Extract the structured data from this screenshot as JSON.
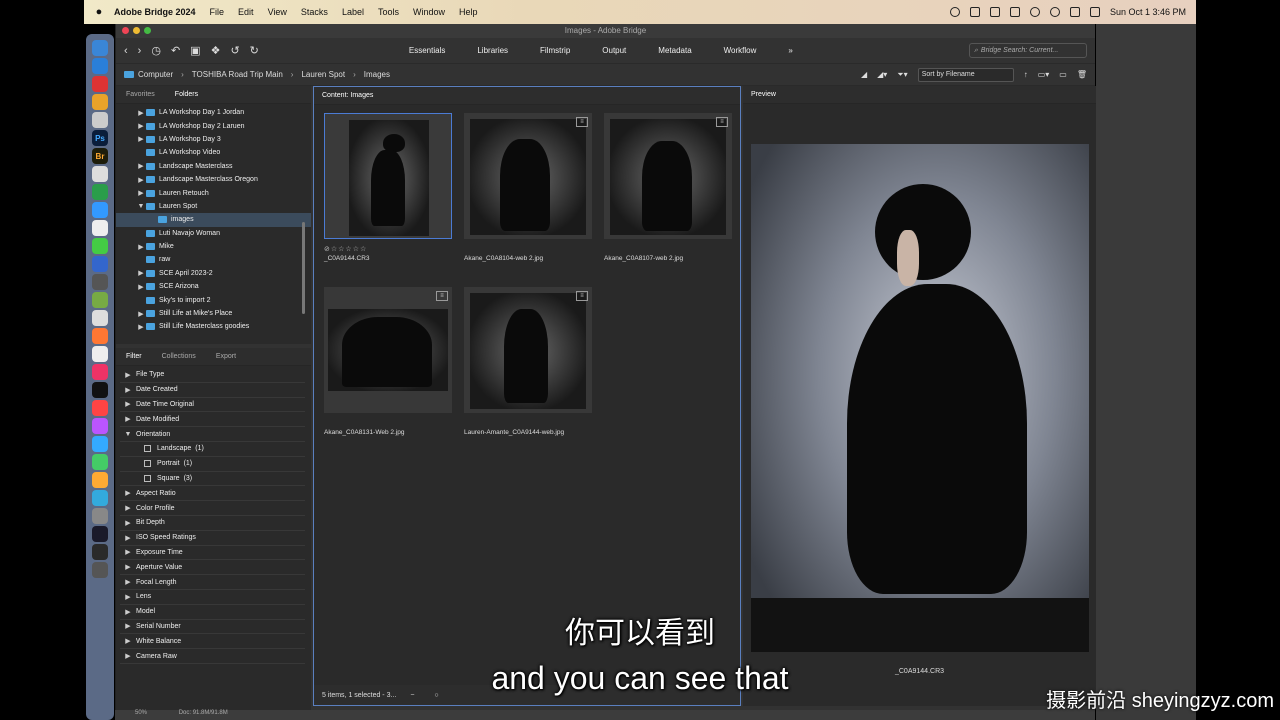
{
  "menubar": {
    "app_name": "Adobe Bridge 2024",
    "menus": [
      "File",
      "Edit",
      "View",
      "Stacks",
      "Label",
      "Tools",
      "Window",
      "Help"
    ],
    "clock": "Sun Oct 1  3:46 PM"
  },
  "window": {
    "title": "Images - Adobe Bridge",
    "workspaces": [
      "Essentials",
      "Libraries",
      "Filmstrip",
      "Output",
      "Metadata",
      "Workflow"
    ],
    "search_placeholder": "Bridge Search: Current..."
  },
  "path": [
    "Computer",
    "TOSHIBA Road Trip Main",
    "Lauren Spot",
    "Images"
  ],
  "sort_label": "Sort by Filename",
  "left_tabs": [
    "Favorites",
    "Folders"
  ],
  "folders": [
    {
      "label": "LA Workshop Day 1 Jordan",
      "arrow": "▶",
      "indent": 0
    },
    {
      "label": "LA Workshop Day 2 Laruen",
      "arrow": "▶",
      "indent": 0
    },
    {
      "label": "LA Workshop Day 3",
      "arrow": "▶",
      "indent": 0
    },
    {
      "label": "LA Workshop Video",
      "arrow": "",
      "indent": 0
    },
    {
      "label": "Landscape Masterclass",
      "arrow": "▶",
      "indent": 0
    },
    {
      "label": "Landscape Masterclass Oregon",
      "arrow": "▶",
      "indent": 0
    },
    {
      "label": "Lauren Retouch",
      "arrow": "▶",
      "indent": 0
    },
    {
      "label": "Lauren Spot",
      "arrow": "▼",
      "indent": 0
    },
    {
      "label": "images",
      "arrow": "",
      "indent": 1
    },
    {
      "label": "Luti Navajo Woman",
      "arrow": "",
      "indent": 0
    },
    {
      "label": "Mike",
      "arrow": "▶",
      "indent": 0
    },
    {
      "label": "raw",
      "arrow": "",
      "indent": 0
    },
    {
      "label": "SCE April 2023-2",
      "arrow": "▶",
      "indent": 0
    },
    {
      "label": "SCE Arizona",
      "arrow": "▶",
      "indent": 0
    },
    {
      "label": "Sky's to import 2",
      "arrow": "",
      "indent": 0
    },
    {
      "label": "Still Life at Mike's Place",
      "arrow": "▶",
      "indent": 0
    },
    {
      "label": "Still Life Masterclass goodies",
      "arrow": "▶",
      "indent": 0
    }
  ],
  "filter_tabs": [
    "Filter",
    "Collections",
    "Export"
  ],
  "filters": [
    {
      "label": "File Type",
      "arrow": "▶"
    },
    {
      "label": "Date Created",
      "arrow": "▶"
    },
    {
      "label": "Date Time Original",
      "arrow": "▶"
    },
    {
      "label": "Date Modified",
      "arrow": "▶"
    },
    {
      "label": "Orientation",
      "arrow": "▼"
    },
    {
      "label": "Landscape",
      "count": "(1)",
      "checkbox": true
    },
    {
      "label": "Portrait",
      "count": "(1)",
      "checkbox": true
    },
    {
      "label": "Square",
      "count": "(3)",
      "checkbox": true
    },
    {
      "label": "Aspect Ratio",
      "arrow": "▶"
    },
    {
      "label": "Color Profile",
      "arrow": "▶"
    },
    {
      "label": "Bit Depth",
      "arrow": "▶"
    },
    {
      "label": "ISO Speed Ratings",
      "arrow": "▶"
    },
    {
      "label": "Exposure Time",
      "arrow": "▶"
    },
    {
      "label": "Aperture Value",
      "arrow": "▶"
    },
    {
      "label": "Focal Length",
      "arrow": "▶"
    },
    {
      "label": "Lens",
      "arrow": "▶"
    },
    {
      "label": "Model",
      "arrow": "▶"
    },
    {
      "label": "Serial Number",
      "arrow": "▶"
    },
    {
      "label": "White Balance",
      "arrow": "▶"
    },
    {
      "label": "Camera Raw",
      "arrow": "▶"
    }
  ],
  "content": {
    "tab": "Content: Images",
    "thumbs": [
      {
        "name": "_C0A9144.CR3",
        "stars": "⊘☆☆☆☆☆"
      },
      {
        "name": "Akane_C0A8104-web 2.jpg"
      },
      {
        "name": "Akane_C0A8107-web 2.jpg"
      },
      {
        "name": "Akane_C0A8131-Web 2.jpg"
      },
      {
        "name": "Lauren-Amante_C0A9144-web.jpg"
      }
    ],
    "status": "5 items, 1 selected - 3..."
  },
  "preview": {
    "tab": "Preview",
    "filename": "_C0A9144.CR3"
  },
  "bottom": {
    "zoom": "50%",
    "doc": "Doc: 91.8M/91.8M"
  },
  "subtitles": {
    "zh": "你可以看到",
    "en": "and you can see that"
  },
  "watermark": "摄影前沿 sheyingzyz.com"
}
